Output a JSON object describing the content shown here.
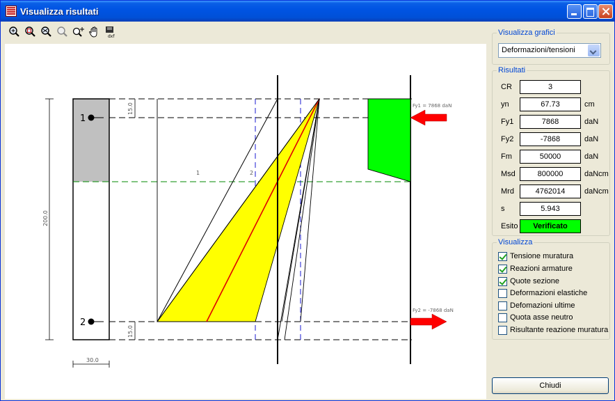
{
  "window": {
    "title": "Visualizza risultati"
  },
  "toolbar": {
    "tools": [
      {
        "icon": "zoom-in-icon"
      },
      {
        "icon": "zoom-window-icon"
      },
      {
        "icon": "zoom-extents-icon"
      },
      {
        "icon": "zoom-previous-icon"
      },
      {
        "icon": "zoom-realtime-icon"
      },
      {
        "icon": "pan-hand-icon"
      },
      {
        "icon": "export-dxf-icon"
      }
    ]
  },
  "drawing": {
    "bar_labels": [
      "1",
      "2"
    ],
    "dim_total": "200.0",
    "dim_top": "15.0",
    "dim_bottom": "15.0",
    "dim_width": "30.0",
    "line_label_1": "1",
    "line_label_2": "2",
    "force_top": "Fy1 =  7868 daN",
    "force_bottom": "Fy2 = -7868 daN"
  },
  "panel": {
    "grafici_title": "Visualizza grafici",
    "grafici_value": "Deformazioni/tensioni",
    "risultati_title": "Risultati",
    "risultati": [
      {
        "label": "CR",
        "value": "3",
        "unit": ""
      },
      {
        "label": "yn",
        "value": "67.73",
        "unit": "cm"
      },
      {
        "label": "Fy1",
        "value": "7868",
        "unit": "daN"
      },
      {
        "label": "Fy2",
        "value": "-7868",
        "unit": "daN"
      },
      {
        "label": "Fm",
        "value": "50000",
        "unit": "daN"
      },
      {
        "label": "Msd",
        "value": "800000",
        "unit": "daNcm"
      },
      {
        "label": "Mrd",
        "value": "4762014",
        "unit": "daNcm"
      },
      {
        "label": "s",
        "value": "5.943",
        "unit": ""
      }
    ],
    "esito_label": "Esito",
    "esito_value": "Verificato",
    "visualizza_title": "Visualizza",
    "options": [
      {
        "label": "Tensione muratura",
        "checked": true
      },
      {
        "label": "Reazioni armature",
        "checked": true
      },
      {
        "label": "Quote sezione",
        "checked": true
      },
      {
        "label": "Deformazioni elastiche",
        "checked": false
      },
      {
        "label": "Defomazioni ultime",
        "checked": false
      },
      {
        "label": "Quota asse neutro",
        "checked": false
      },
      {
        "label": "Risultante reazione muratura",
        "checked": false
      }
    ],
    "close_label": "Chiudi"
  },
  "colors": {
    "compressed_zone": "#c0c0c0",
    "stress_block": "#00ff00",
    "strain_triangle": "#ffff00",
    "arrow": "#ff0000",
    "esito": "#00ff00"
  }
}
